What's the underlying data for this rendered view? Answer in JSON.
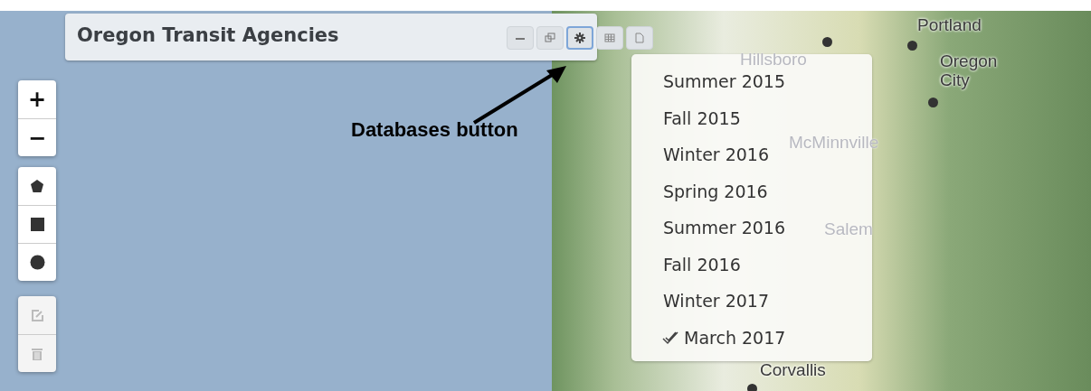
{
  "panel": {
    "title": "Oregon Transit Agencies",
    "buttons": [
      {
        "kind": "minimize",
        "selected": false
      },
      {
        "kind": "restore",
        "selected": false
      },
      {
        "kind": "gear",
        "selected": true
      },
      {
        "kind": "table",
        "selected": false
      },
      {
        "kind": "page",
        "selected": false
      }
    ]
  },
  "zoom_controls": [
    {
      "label": "+"
    },
    {
      "label": "−"
    }
  ],
  "draw_tools": [
    {
      "kind": "polygon"
    },
    {
      "kind": "rectangle"
    },
    {
      "kind": "circle"
    }
  ],
  "edit_tools": [
    {
      "kind": "edit",
      "disabled": true
    },
    {
      "kind": "delete",
      "disabled": true
    }
  ],
  "database_menu": [
    {
      "label": "Summer 2015",
      "checked": false
    },
    {
      "label": "Fall 2015",
      "checked": false
    },
    {
      "label": "Winter 2016",
      "checked": false
    },
    {
      "label": "Spring 2016",
      "checked": false
    },
    {
      "label": "Summer 2016",
      "checked": false
    },
    {
      "label": "Fall 2016",
      "checked": false
    },
    {
      "label": "Winter 2017",
      "checked": false
    },
    {
      "label": "March 2017",
      "checked": true
    }
  ],
  "map_labels": [
    {
      "label": "Portland"
    },
    {
      "label": "Hillsboro"
    },
    {
      "label": "Oregon City"
    },
    {
      "label": "McMinnville"
    },
    {
      "label": "Salem"
    },
    {
      "label": "Corvallis"
    }
  ],
  "annotation": {
    "label": "Databases button"
  }
}
